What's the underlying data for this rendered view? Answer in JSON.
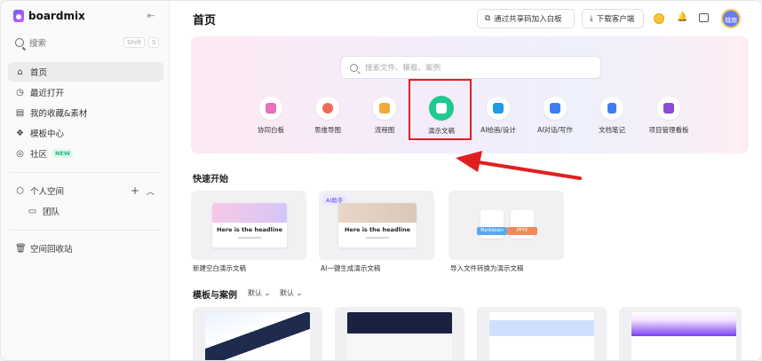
{
  "app": {
    "brand": "boardmix"
  },
  "sidebar": {
    "search_label": "搜索",
    "shortcut": [
      "Shift",
      "S"
    ],
    "items": [
      {
        "label": "首页",
        "icon": "home-icon"
      },
      {
        "label": "最近打开",
        "icon": "clock-icon"
      },
      {
        "label": "我的收藏&素材",
        "icon": "collection-icon"
      },
      {
        "label": "模板中心",
        "icon": "template-icon"
      },
      {
        "label": "社区",
        "icon": "community-icon",
        "badge": "NEW"
      }
    ],
    "personal_space": "个人空间",
    "team": "团队",
    "trash": "空间回收站"
  },
  "header": {
    "title": "首页",
    "join_button": "通过共享码加入白板",
    "download_button": "下载客户端",
    "avatar_text": "城南"
  },
  "hero": {
    "search_placeholder": "搜索文件、模板、案例",
    "tools": [
      {
        "label": "协同白板",
        "color": "#e86fbd"
      },
      {
        "label": "思维导图",
        "color": "#f06a5a"
      },
      {
        "label": "流程图",
        "color": "#f2a93b"
      },
      {
        "label": "演示文稿",
        "color": "#1fc990"
      },
      {
        "label": "AI绘画/设计",
        "color": "#1f9be8"
      },
      {
        "label": "AI对话/写作",
        "color": "#3d7cf2"
      },
      {
        "label": "文档笔记",
        "color": "#3d7cf2"
      },
      {
        "label": "项目管理看板",
        "color": "#8b4ad8"
      }
    ]
  },
  "quick_start": {
    "title": "快速开始",
    "cards": [
      {
        "label": "新建空白演示文稿",
        "headline": "Here is the headline"
      },
      {
        "label": "AI一键生成演示文稿",
        "headline": "Here is the headline",
        "tag": "AI助手"
      },
      {
        "label": "导入文件转换为演示文稿",
        "chips": [
          "Markdown",
          "PPTX"
        ]
      }
    ]
  },
  "templates": {
    "title": "模板与案例",
    "filters": [
      "默认",
      "默认"
    ]
  }
}
